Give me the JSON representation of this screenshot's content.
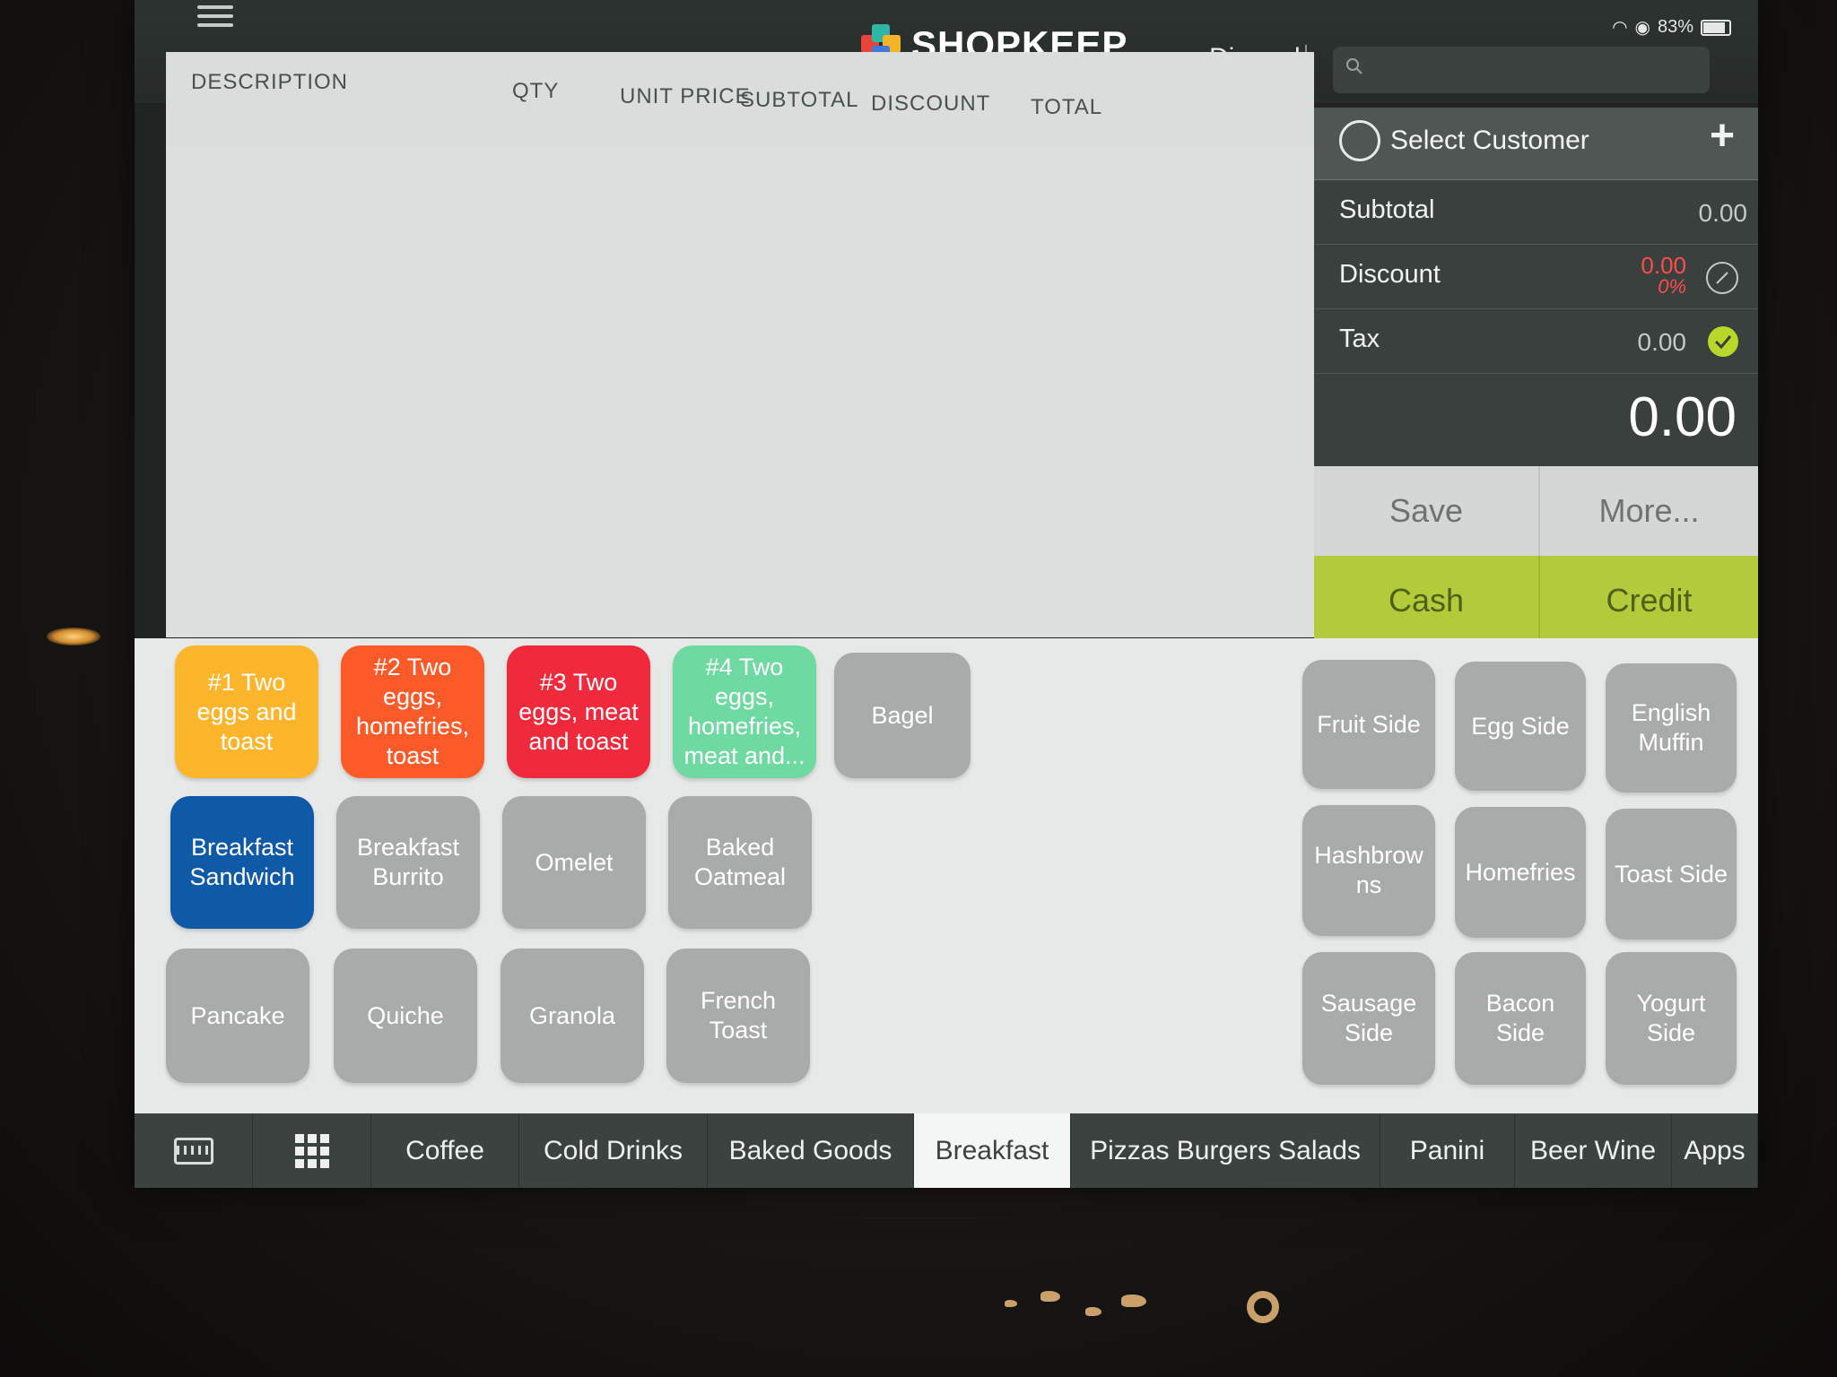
{
  "status_bar": {
    "battery": "83%"
  },
  "header": {
    "app_name": "SHOPKEEP",
    "discard_label": "Discard",
    "search_placeholder": ""
  },
  "order_table": {
    "columns": [
      "DESCRIPTION",
      "QTY",
      "UNIT PRICE",
      "SUBTOTAL",
      "DISCOUNT",
      "TOTAL"
    ],
    "rows": []
  },
  "totals": {
    "customer_label": "Select Customer",
    "subtotal_label": "Subtotal",
    "subtotal_value": "0.00",
    "discount_label": "Discount",
    "discount_value": "0.00",
    "discount_percent": "0%",
    "tax_label": "Tax",
    "tax_value": "0.00",
    "grand_total": "0.00",
    "save_label": "Save",
    "more_label": "More...",
    "cash_label": "Cash",
    "credit_label": "Credit"
  },
  "products": {
    "p1": {
      "label": "#1 Two eggs and toast",
      "color": "#fdb52c"
    },
    "p2": {
      "label": "#2 Two eggs, homefries, toast",
      "color": "#fd5a2a"
    },
    "p3": {
      "label": "#3 Two eggs, meat and toast",
      "color": "#ee2a3c"
    },
    "p4": {
      "label": "#4 Two eggs, homefries, meat and...",
      "color": "#6fd9a2"
    },
    "p5": {
      "label": "Bagel",
      "color": "#a9abaa"
    },
    "p6": {
      "label": "Breakfast Sandwich",
      "color": "#0f5aa6"
    },
    "p7": {
      "label": "Breakfast Burrito",
      "color": "#a9abaa"
    },
    "p8": {
      "label": "Omelet",
      "color": "#a9abaa"
    },
    "p9": {
      "label": "Baked Oatmeal",
      "color": "#a9abaa"
    },
    "p10": {
      "label": "Pancake",
      "color": "#a9abaa"
    },
    "p11": {
      "label": "Quiche",
      "color": "#a9abaa"
    },
    "p12": {
      "label": "Granola",
      "color": "#a9abaa"
    },
    "p13": {
      "label": "French Toast",
      "color": "#a9abaa"
    },
    "s1": {
      "label": "Fruit Side",
      "color": "#a9abaa"
    },
    "s2": {
      "label": "Egg Side",
      "color": "#a9abaa"
    },
    "s3": {
      "label": "English Muffin",
      "color": "#a9abaa"
    },
    "s4": {
      "label": "Hashbrow ns",
      "color": "#a9abaa"
    },
    "s5": {
      "label": "Homefries",
      "color": "#a9abaa"
    },
    "s6": {
      "label": "Toast Side",
      "color": "#a9abaa"
    },
    "s7": {
      "label": "Sausage Side",
      "color": "#a9abaa"
    },
    "s8": {
      "label": "Bacon Side",
      "color": "#a9abaa"
    },
    "s9": {
      "label": "Yogurt Side",
      "color": "#a9abaa"
    }
  },
  "tabs": {
    "keyboard_icon": "keyboard-icon",
    "grid_icon": "grid-icon",
    "coffee": "Coffee",
    "cold_drinks": "Cold Drinks",
    "baked_goods": "Baked Goods",
    "breakfast": "Breakfast",
    "pizzas": "Pizzas Burgers Salads",
    "panini": "Panini",
    "beer_wine": "Beer Wine",
    "apps": "Apps",
    "active": "Breakfast"
  },
  "colors": {
    "accent_green": "#b3cb3a",
    "discount_red": "#ff4b4b",
    "panel_dark": "#3a403e"
  }
}
